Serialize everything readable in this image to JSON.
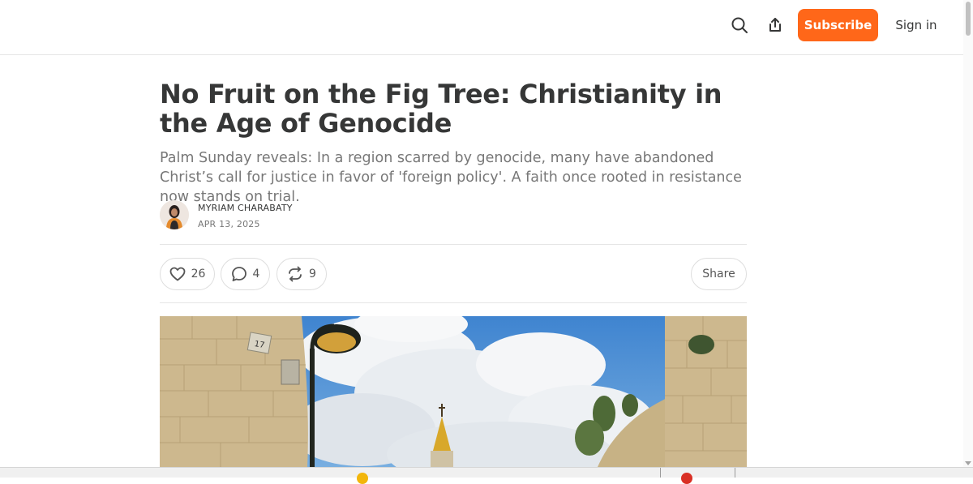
{
  "header": {
    "subscribe_label": "Subscribe",
    "signin_label": "Sign in",
    "icons": [
      "search-icon",
      "share-arrow-icon"
    ],
    "accent_color": "#ff6719"
  },
  "post": {
    "title": "No Fruit on the Fig Tree: Christianity in the Age of Genocide",
    "subtitle": "Palm Sunday reveals: In a region scarred by genocide, many have abandoned Christ’s call for justice in favor of 'foreign policy'. A faith once rooted in resistance now stands on trial.",
    "author": "MYRIAM CHARABATY",
    "date": "APR 13, 2025"
  },
  "actions": {
    "likes": "26",
    "comments": "4",
    "restacks": "9",
    "share_label": "Share"
  },
  "hero_image": {
    "sign_number": "17"
  }
}
